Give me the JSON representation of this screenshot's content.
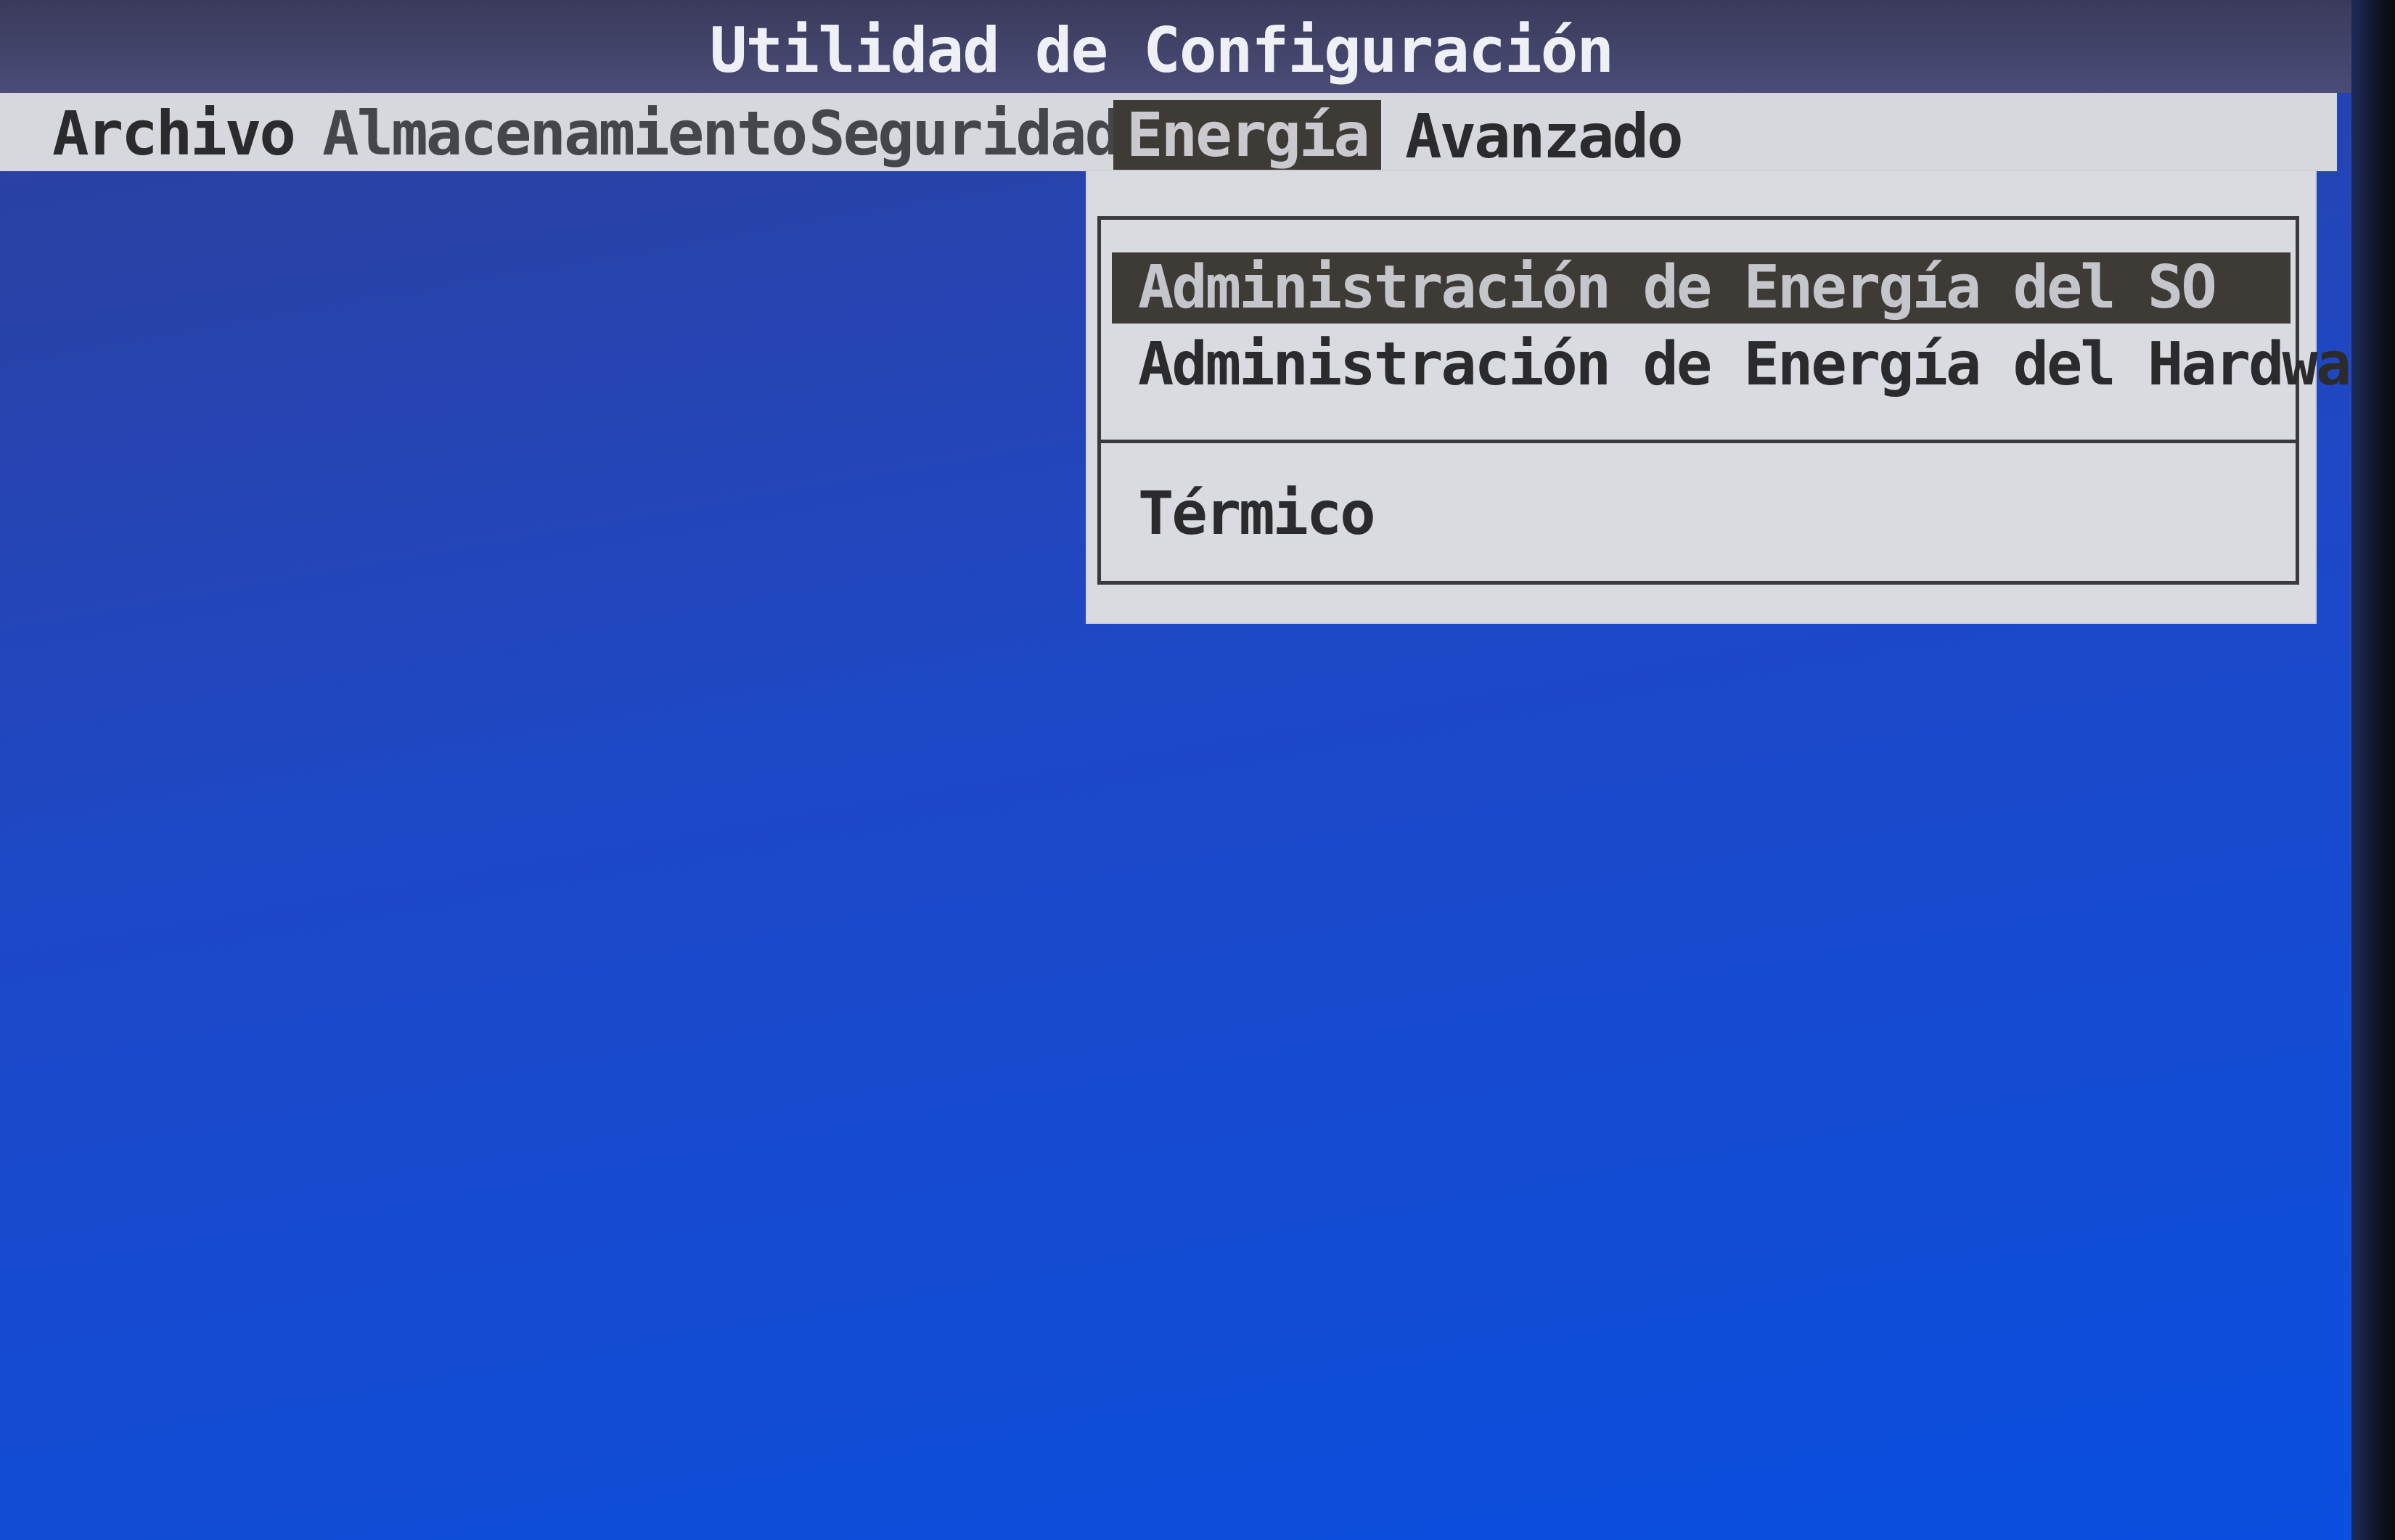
{
  "window": {
    "title": "Utilidad de Configuración"
  },
  "menu": {
    "items": [
      {
        "label": "Archivo"
      },
      {
        "label": "Almacenamiento"
      },
      {
        "label": "Seguridad"
      },
      {
        "label": "Energía",
        "active": true
      },
      {
        "label": "Avanzado"
      }
    ]
  },
  "dropdown": {
    "items": [
      {
        "label": "Administración de Energía del SO",
        "selected": true
      },
      {
        "label": "Administración de Energía del Hardware"
      },
      {
        "label": "Térmico"
      }
    ]
  },
  "colors": {
    "background": "#1e48c6",
    "menu_bar": "#d6d8dd",
    "highlight": "#3e3b36"
  }
}
